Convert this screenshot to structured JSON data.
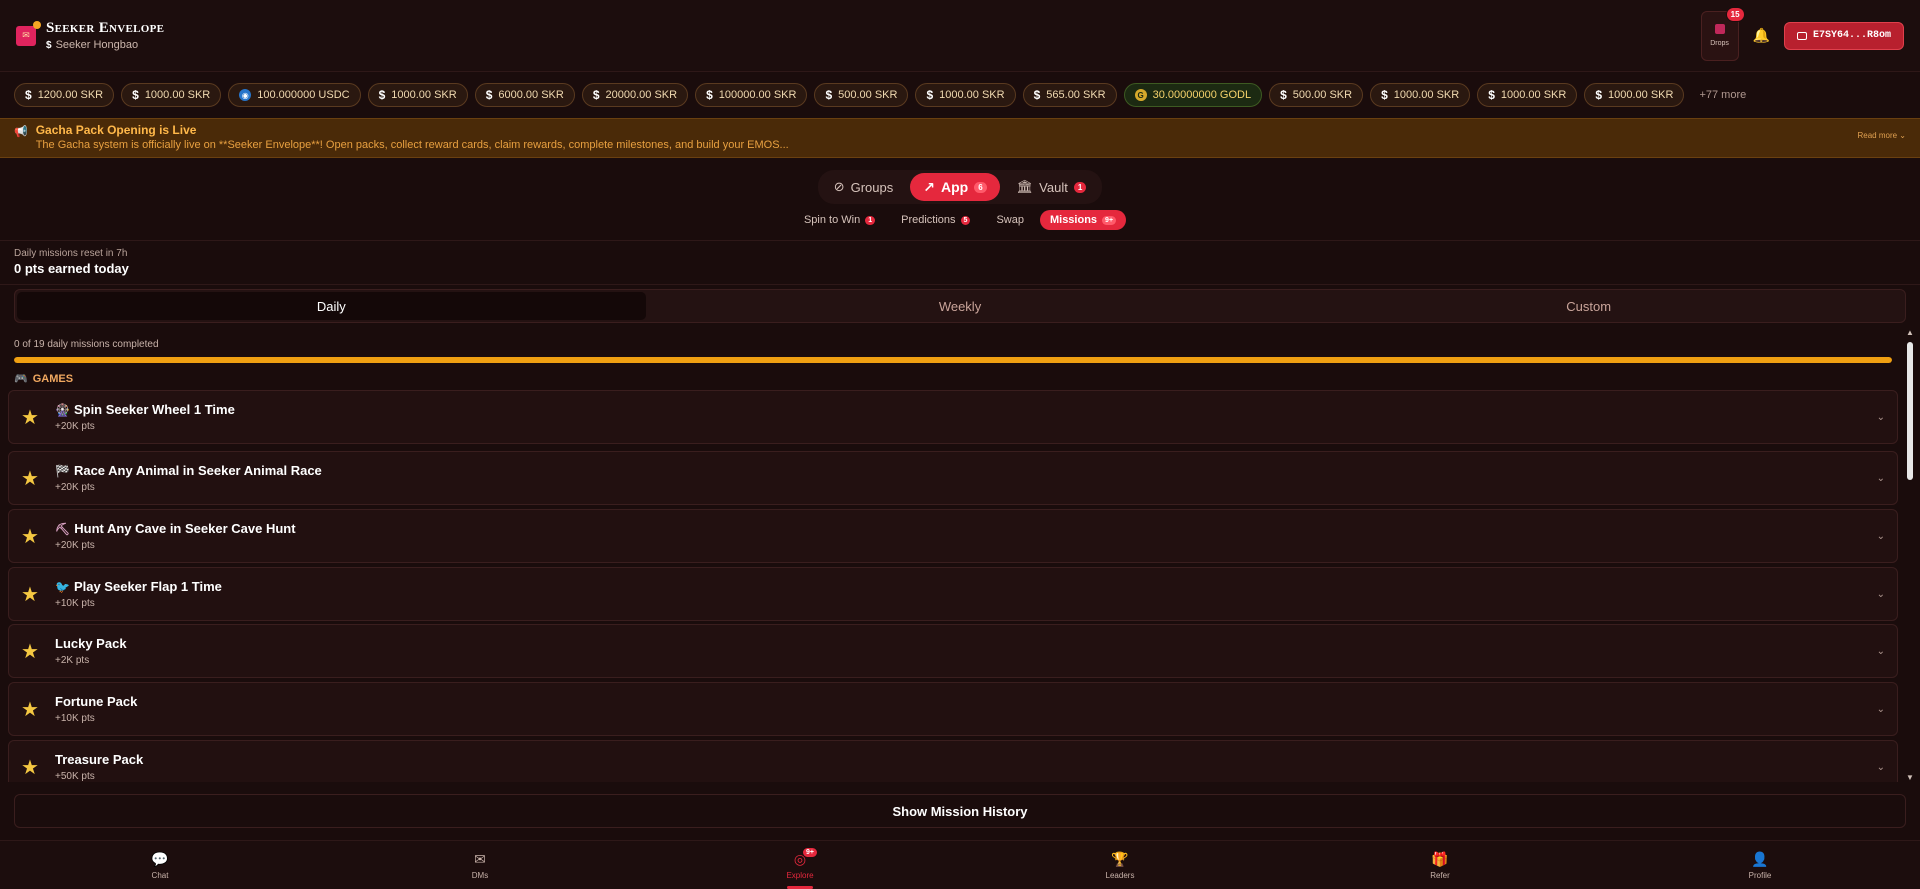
{
  "app": {
    "title": "Seeker Envelope",
    "subtitle": "Seeker Hongbao",
    "subtitle_icon": "$"
  },
  "header": {
    "drops_label": "Drops",
    "drops_badge": "15",
    "wallet_address": "E7SY64...R8om"
  },
  "tokens": [
    {
      "amount": "1200.00 SKR",
      "kind": "skr"
    },
    {
      "amount": "1000.00 SKR",
      "kind": "skr"
    },
    {
      "amount": "100.000000 USDC",
      "kind": "usdc"
    },
    {
      "amount": "1000.00 SKR",
      "kind": "skr"
    },
    {
      "amount": "6000.00 SKR",
      "kind": "skr"
    },
    {
      "amount": "20000.00 SKR",
      "kind": "skr"
    },
    {
      "amount": "100000.00 SKR",
      "kind": "skr"
    },
    {
      "amount": "500.00 SKR",
      "kind": "skr"
    },
    {
      "amount": "1000.00 SKR",
      "kind": "skr"
    },
    {
      "amount": "565.00 SKR",
      "kind": "skr"
    },
    {
      "amount": "30.00000000 GODL",
      "kind": "godl"
    },
    {
      "amount": "500.00 SKR",
      "kind": "skr"
    },
    {
      "amount": "1000.00 SKR",
      "kind": "skr"
    },
    {
      "amount": "1000.00 SKR",
      "kind": "skr"
    },
    {
      "amount": "1000.00 SKR",
      "kind": "skr"
    }
  ],
  "tokens_more": "+77 more",
  "announcement": {
    "title": "Gacha Pack Opening is Live",
    "body": "The Gacha system is officially live on **Seeker Envelope**! Open packs, collect reward cards, claim rewards, complete milestones, and build your EMOS...",
    "read_more": "Read more ⌄"
  },
  "main_tabs": [
    {
      "label": "Groups",
      "icon": "⊘",
      "badge": "",
      "active": false
    },
    {
      "label": "App",
      "icon": "↗",
      "badge": "6",
      "active": true
    },
    {
      "label": "Vault",
      "icon": "🏛",
      "badge": "1",
      "active": false
    }
  ],
  "sub_tabs": [
    {
      "label": "Spin to Win",
      "badge": "1",
      "active": false
    },
    {
      "label": "Predictions",
      "badge": "5",
      "active": false
    },
    {
      "label": "Swap",
      "badge": "",
      "active": false
    },
    {
      "label": "Missions",
      "badge": "9+",
      "active": true
    }
  ],
  "reset_info": {
    "line1": "Daily missions reset in 7h",
    "line2": "0 pts earned today"
  },
  "period_tabs": [
    {
      "label": "Daily",
      "active": true
    },
    {
      "label": "Weekly",
      "active": false
    },
    {
      "label": "Custom",
      "active": false
    }
  ],
  "progress": {
    "label": "0 of 19 daily missions completed",
    "fraction": 1.0
  },
  "section": {
    "icon": "gamepad-icon",
    "label": "GAMES"
  },
  "missions": [
    {
      "emoji": "🎡",
      "title": "Spin Seeker Wheel 1 Time",
      "points": "+20K pts"
    },
    {
      "emoji": "🏁",
      "title": "Race Any Animal in Seeker Animal Race",
      "points": "+20K pts"
    },
    {
      "emoji": "⛏",
      "title": "Hunt Any Cave in Seeker Cave Hunt",
      "points": "+20K pts"
    },
    {
      "emoji": "🐦",
      "title": "Play Seeker Flap 1 Time",
      "points": "+10K pts"
    },
    {
      "emoji": "",
      "title": "Lucky Pack",
      "points": "+2K pts"
    },
    {
      "emoji": "",
      "title": "Fortune Pack",
      "points": "+10K pts"
    },
    {
      "emoji": "",
      "title": "Treasure Pack",
      "points": "+50K pts"
    }
  ],
  "history_button": "Show Mission History",
  "bottom_nav": [
    {
      "label": "Chat",
      "icon": "chat-icon",
      "glyph": "💬",
      "badge": "",
      "active": false
    },
    {
      "label": "DMs",
      "icon": "mail-icon",
      "glyph": "✉",
      "badge": "",
      "active": false
    },
    {
      "label": "Explore",
      "icon": "compass-icon",
      "glyph": "◎",
      "badge": "9+",
      "active": true
    },
    {
      "label": "Leaders",
      "icon": "trophy-icon",
      "glyph": "🏆",
      "badge": "",
      "active": false
    },
    {
      "label": "Refer",
      "icon": "gift-icon",
      "glyph": "🎁",
      "badge": "",
      "active": false
    },
    {
      "label": "Profile",
      "icon": "user-icon",
      "glyph": "👤",
      "badge": "",
      "active": false
    }
  ],
  "colors": {
    "accent": "#e5283d",
    "progress": "#f0a012",
    "background": "#1a0c0c",
    "star": "#f5c842"
  }
}
